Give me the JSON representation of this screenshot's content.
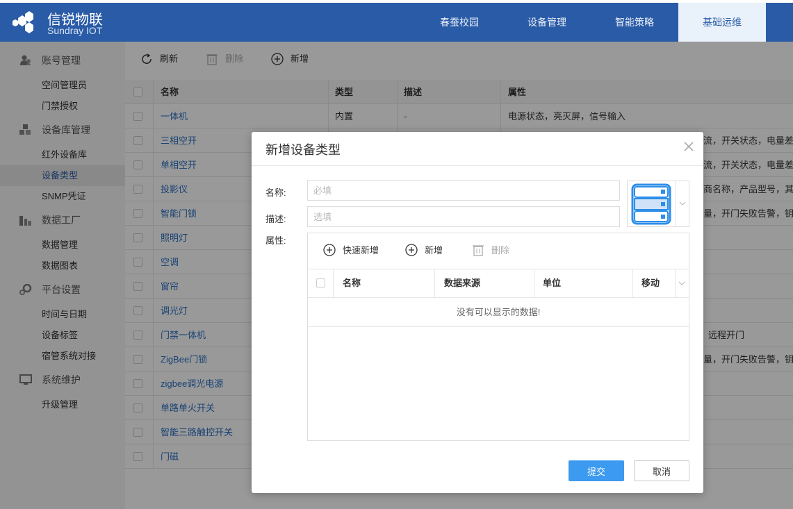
{
  "brand": {
    "name": "信锐物联",
    "sub": "Sundray IOT"
  },
  "nav": [
    {
      "label": "春蚕校园"
    },
    {
      "label": "设备管理"
    },
    {
      "label": "智能策略"
    },
    {
      "label": "基础运维"
    }
  ],
  "sidebar": {
    "groups": [
      {
        "label": "账号管理",
        "icon": "user-group-icon",
        "items": [
          "空间管理员",
          "门禁授权"
        ]
      },
      {
        "label": "设备库管理",
        "icon": "cubes-icon",
        "items": [
          "红外设备库",
          "设备类型",
          "SNMP凭证"
        ]
      },
      {
        "label": "数据工厂",
        "icon": "chart-icon",
        "items": [
          "数据管理",
          "数据图表"
        ]
      },
      {
        "label": "平台设置",
        "icon": "gears-icon",
        "items": [
          "时间与日期",
          "设备标签",
          "宿管系统对接"
        ]
      },
      {
        "label": "系统维护",
        "icon": "monitor-icon",
        "items": [
          "升级管理"
        ]
      }
    ],
    "active_item": "设备类型"
  },
  "toolbar": {
    "refresh": "刷新",
    "delete": "删除",
    "add": "新增"
  },
  "table": {
    "headers": [
      "名称",
      "类型",
      "描述",
      "属性"
    ],
    "rows": [
      [
        "一体机",
        "内置",
        "-",
        "电源状态，亮灭屏，信号输入"
      ],
      [
        "三相空开",
        "",
        "",
        "流，开关状态，电量差值"
      ],
      [
        "单相空开",
        "",
        "",
        "流，开关状态，电量差值"
      ],
      [
        "投影仪",
        "",
        "",
        "商名称，产品型号，其他信"
      ],
      [
        "智能门锁",
        "",
        "",
        "量，开门失败告警，钥匙开"
      ],
      [
        "照明灯",
        "",
        "",
        ""
      ],
      [
        "空调",
        "",
        "",
        ""
      ],
      [
        "窗帘",
        "",
        "",
        ""
      ],
      [
        "调光灯",
        "",
        "",
        ""
      ],
      [
        "门禁一体机",
        "",
        "",
        "远程开门"
      ],
      [
        "ZigBee门锁",
        "",
        "",
        "量，开门失败告警，钥匙开"
      ],
      [
        "zigbee调光电源",
        "",
        "",
        ""
      ],
      [
        "单路单火开关",
        "",
        "",
        ""
      ],
      [
        "智能三路触控开关",
        "",
        "",
        ""
      ],
      [
        "门磁",
        "",
        "",
        ""
      ]
    ]
  },
  "modal": {
    "title": "新增设备类型",
    "name_label": "名称:",
    "name_placeholder": "必填",
    "desc_label": "描述:",
    "desc_placeholder": "选填",
    "attr_label": "属性:",
    "attr_toolbar": {
      "quick_add": "快速新增",
      "add": "新增",
      "delete": "删除"
    },
    "attr_headers": [
      "名称",
      "数据来源",
      "单位",
      "移动"
    ],
    "attr_empty": "没有可以显示的数据!",
    "submit": "提交",
    "cancel": "取消"
  },
  "colors": {
    "header": "#2a5ba6",
    "accent": "#3c9af0",
    "link": "#2a6ec2"
  }
}
